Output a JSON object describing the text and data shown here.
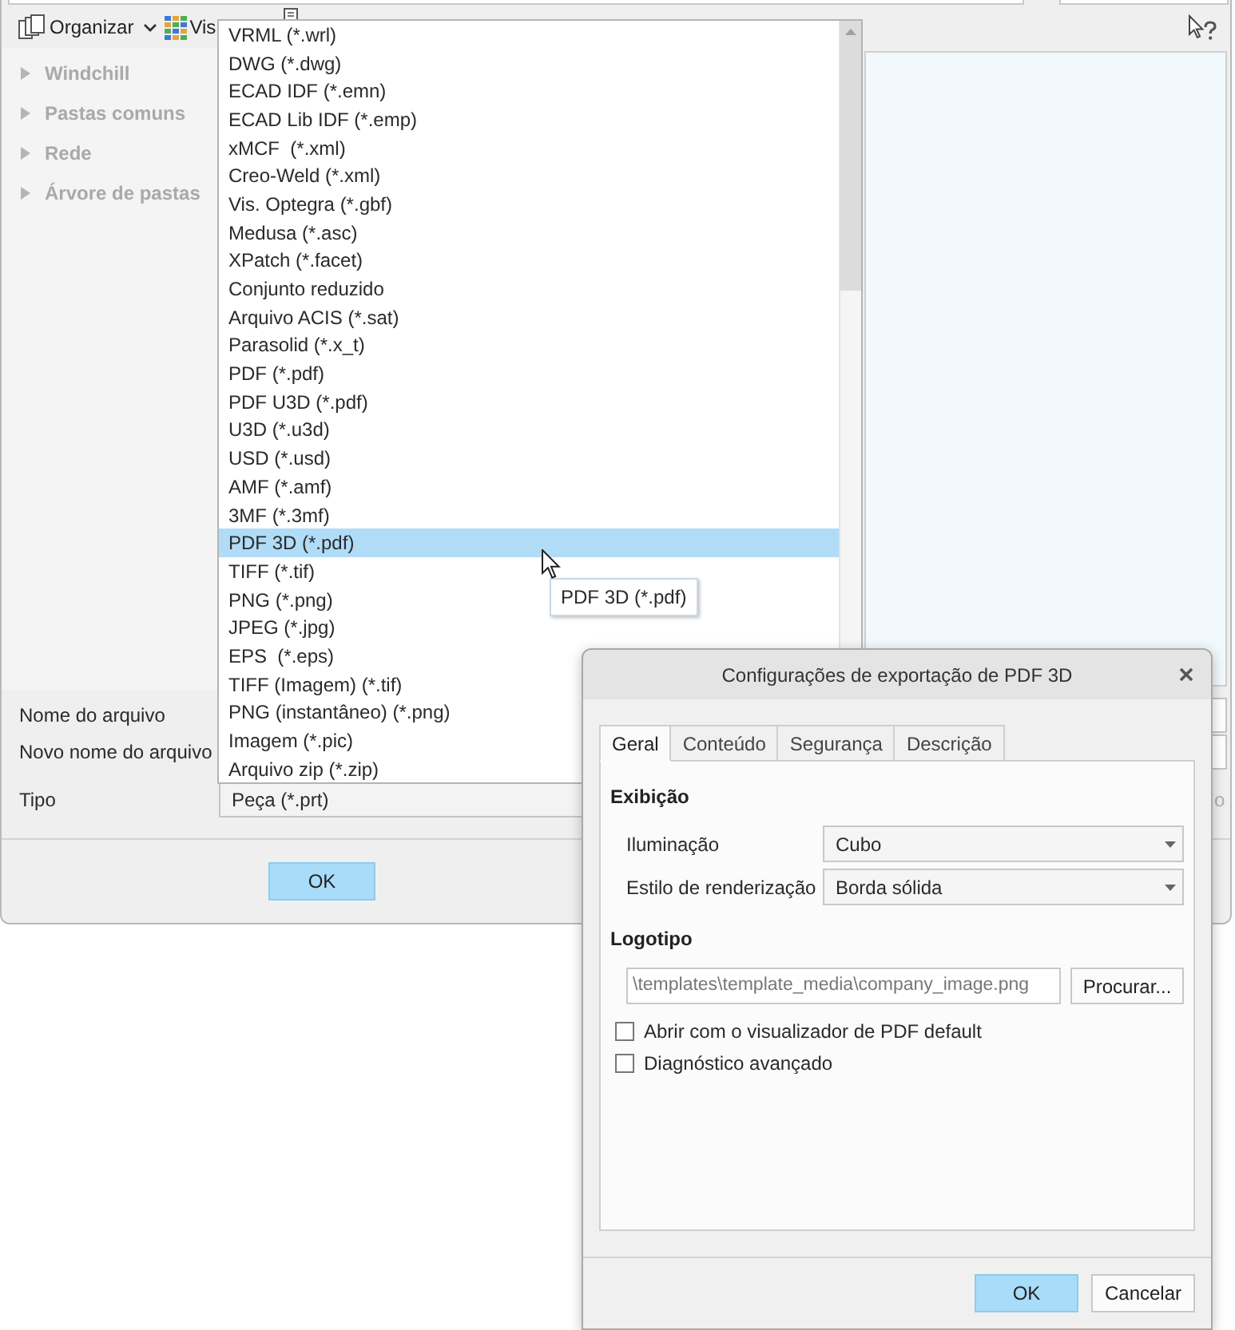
{
  "file_dialog": {
    "toolbar": {
      "organize": "Organizar",
      "view": "Vis"
    },
    "nav_items": [
      {
        "label": "Windchill",
        "disabled": true
      },
      {
        "label": "Pastas comuns",
        "disabled": true
      },
      {
        "label": "Rede",
        "disabled": true
      },
      {
        "label": "Árvore de pastas",
        "disabled": true
      }
    ],
    "form": {
      "name_label": "Nome do arquivo",
      "new_name_label": "Novo nome do arquivo",
      "type_label": "Tipo",
      "type_value": "Peça (*.prt)",
      "type_side_text": "o"
    },
    "buttons": [
      {
        "label": "OK",
        "primary": true
      }
    ]
  },
  "type_list": {
    "items": [
      {
        "label": "VRML (*.wrl)",
        "selected": false
      },
      {
        "label": "DWG (*.dwg)",
        "selected": false
      },
      {
        "label": "ECAD IDF (*.emn)",
        "selected": false
      },
      {
        "label": "ECAD Lib IDF (*.emp)",
        "selected": false
      },
      {
        "label": "xMCF  (*.xml)",
        "selected": false
      },
      {
        "label": "Creo-Weld (*.xml)",
        "selected": false
      },
      {
        "label": "Vis. Optegra (*.gbf)",
        "selected": false
      },
      {
        "label": "Medusa (*.asc)",
        "selected": false
      },
      {
        "label": "XPatch (*.facet)",
        "selected": false
      },
      {
        "label": "Conjunto reduzido",
        "selected": false
      },
      {
        "label": "Arquivo ACIS (*.sat)",
        "selected": false
      },
      {
        "label": "Parasolid (*.x_t)",
        "selected": false
      },
      {
        "label": "PDF (*.pdf)",
        "selected": false
      },
      {
        "label": "PDF U3D (*.pdf)",
        "selected": false
      },
      {
        "label": "U3D (*.u3d)",
        "selected": false
      },
      {
        "label": "USD (*.usd)",
        "selected": false
      },
      {
        "label": "AMF (*.amf)",
        "selected": false
      },
      {
        "label": "3MF (*.3mf)",
        "selected": false
      },
      {
        "label": "PDF 3D (*.pdf)",
        "selected": true
      },
      {
        "label": "TIFF (*.tif)",
        "selected": false
      },
      {
        "label": "PNG (*.png)",
        "selected": false
      },
      {
        "label": "JPEG (*.jpg)",
        "selected": false
      },
      {
        "label": "EPS  (*.eps)",
        "selected": false
      },
      {
        "label": "TIFF (Imagem) (*.tif)",
        "selected": false
      },
      {
        "label": "PNG (instantâneo) (*.png)",
        "selected": false
      },
      {
        "label": "Imagem (*.pic)",
        "selected": false
      },
      {
        "label": "Arquivo zip (*.zip)",
        "selected": false
      }
    ]
  },
  "tooltip": "PDF 3D (*.pdf)",
  "export_dialog": {
    "title": "Configurações de exportação de PDF 3D",
    "tabs": [
      {
        "label": "Geral",
        "selected": true
      },
      {
        "label": "Conteúdo",
        "selected": false
      },
      {
        "label": "Segurança",
        "selected": false
      },
      {
        "label": "Descrição",
        "selected": false
      }
    ],
    "display_heading": "Exibição",
    "fields": [
      {
        "label": "Iluminação",
        "value": "Cubo"
      },
      {
        "label": "Estilo de renderização",
        "value": "Borda sólida"
      }
    ],
    "logo_heading": "Logotipo",
    "logo_path": "\\templates\\template_media\\company_image.png",
    "browse": "Procurar...",
    "options": [
      {
        "label": "Abrir com o visualizador de PDF default",
        "checked": false
      },
      {
        "label": "Diagnóstico avançado",
        "checked": false
      }
    ],
    "buttons": [
      {
        "label": "OK",
        "primary": true
      },
      {
        "label": "Cancelar",
        "primary": false
      }
    ]
  }
}
